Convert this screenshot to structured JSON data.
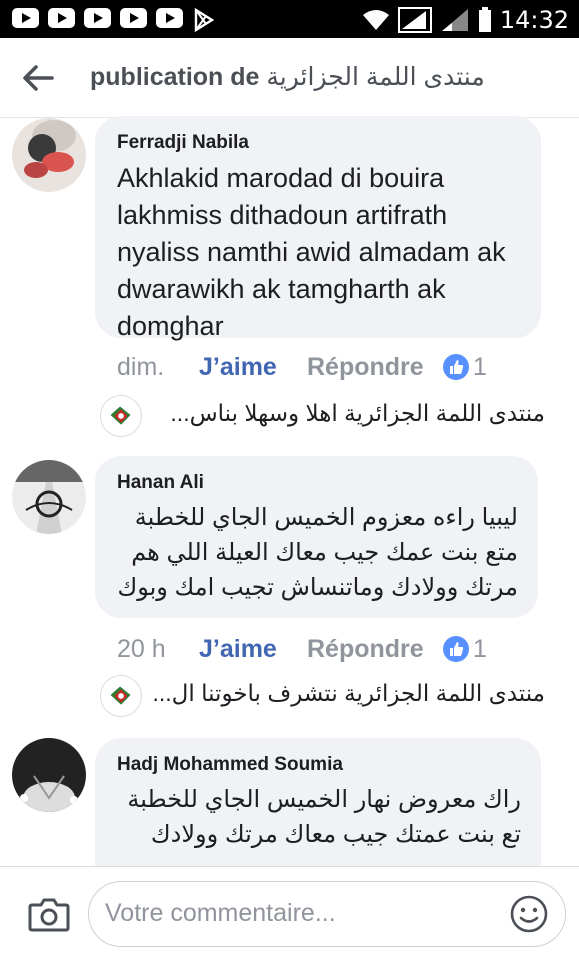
{
  "status_bar": {
    "time": "14:32"
  },
  "header": {
    "title_prefix": "publication de",
    "title_page": "منتدى اللمة الجزائرية"
  },
  "comments": [
    {
      "author": "Ferradji Nabila",
      "text": "Akhlakid marodad di bouira lakhmiss dithadoun artifrath nyaliss namthi awid almadam ak dwarawikh ak tamgharth ak domghar",
      "time": "dim.",
      "like_label": "J’aime",
      "reply_label": "Répondre",
      "likes": "1",
      "reply_preview": {
        "author": "منتدى اللمة الجزائرية",
        "text": "اهلا وسهلا بناس..."
      }
    },
    {
      "author": "Hanan Ali",
      "text": "ليبيا راءه معزوم  الخميس الجاي للخطبة متع بنت عمك جيب معاك  العيلة اللي هم مرتك وولادك  وماتنساش تجيب امك وبوك",
      "time": "20 h",
      "like_label": "J’aime",
      "reply_label": "Répondre",
      "likes": "1",
      "reply_preview": {
        "author": "منتدى اللمة الجزائرية",
        "text": "نتشرف باخوتنا ال..."
      }
    },
    {
      "author": "Hadj Mohammed Soumia",
      "text": "راك معروض نهار الخميس الجاي للخطبة تع بنت عمتك جيب معاك مرتك وولادك"
    }
  ],
  "composer": {
    "placeholder": "Votre commentaire..."
  },
  "colors": {
    "link": "#4267b2",
    "bubble": "#f1f2f6",
    "muted": "#90949c",
    "like_badge": "#5890ff"
  }
}
